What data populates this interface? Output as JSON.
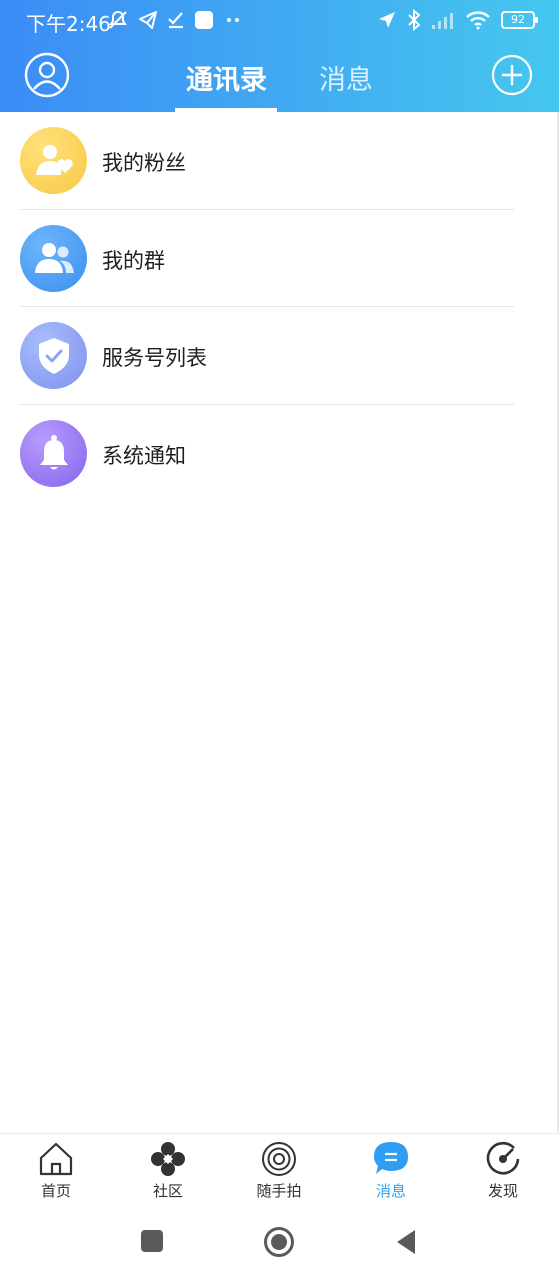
{
  "status_bar": {
    "time": "下午2:46",
    "battery": "92"
  },
  "header": {
    "tabs": [
      {
        "label": "通讯录",
        "active": true
      },
      {
        "label": "消息",
        "active": false
      }
    ]
  },
  "list": {
    "items": [
      {
        "label": "我的粉丝",
        "icon": "fans-icon",
        "color": "#fbd257"
      },
      {
        "label": "我的群",
        "icon": "group-icon",
        "color": "#4a9ff3"
      },
      {
        "label": "服务号列表",
        "icon": "shield-check-icon",
        "color": "#8aa6f5"
      },
      {
        "label": "系统通知",
        "icon": "bell-icon",
        "color": "#9d7ff0"
      }
    ]
  },
  "tabbar": {
    "items": [
      {
        "label": "首页",
        "icon": "home-icon",
        "active": false
      },
      {
        "label": "社区",
        "icon": "community-icon",
        "active": false
      },
      {
        "label": "随手拍",
        "icon": "snapshot-icon",
        "active": false
      },
      {
        "label": "消息",
        "icon": "message-icon",
        "active": true
      },
      {
        "label": "发现",
        "icon": "discover-icon",
        "active": false
      }
    ]
  },
  "colors": {
    "header_start": "#3b8cf6",
    "header_end": "#45c7ee",
    "active_tab": "#2f9ef2"
  }
}
